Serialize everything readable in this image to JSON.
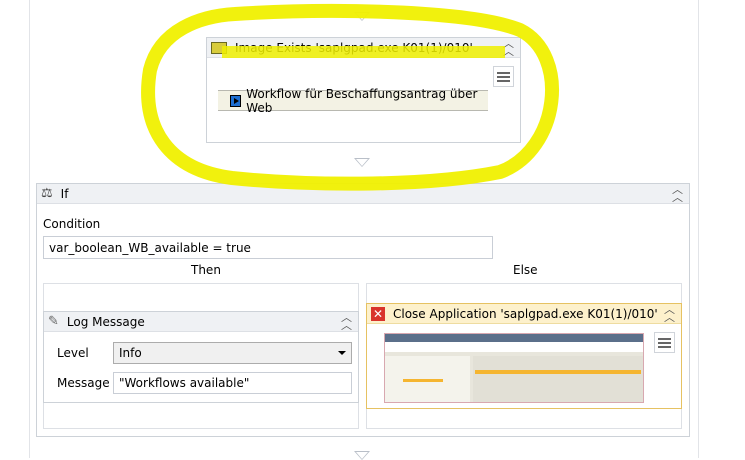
{
  "image_exists": {
    "title": "Image Exists 'saplgpad.exe K01(1)/010'",
    "preview_text": "Workflow für Beschaffungsantrag über Web"
  },
  "if_activity": {
    "title": "If",
    "condition_label": "Condition",
    "condition_value": "var_boolean_WB_available = true",
    "then_label": "Then",
    "else_label": "Else"
  },
  "log_message": {
    "title": "Log Message",
    "level_label": "Level",
    "level_value": "Info",
    "message_label": "Message",
    "message_value": "\"Workflows available\""
  },
  "close_application": {
    "title": "Close Application 'saplgpad.exe K01(1)/010'"
  },
  "colors": {
    "highlight": "#f0f000",
    "close_header": "#fdf1cc",
    "close_border": "#e6c262"
  }
}
